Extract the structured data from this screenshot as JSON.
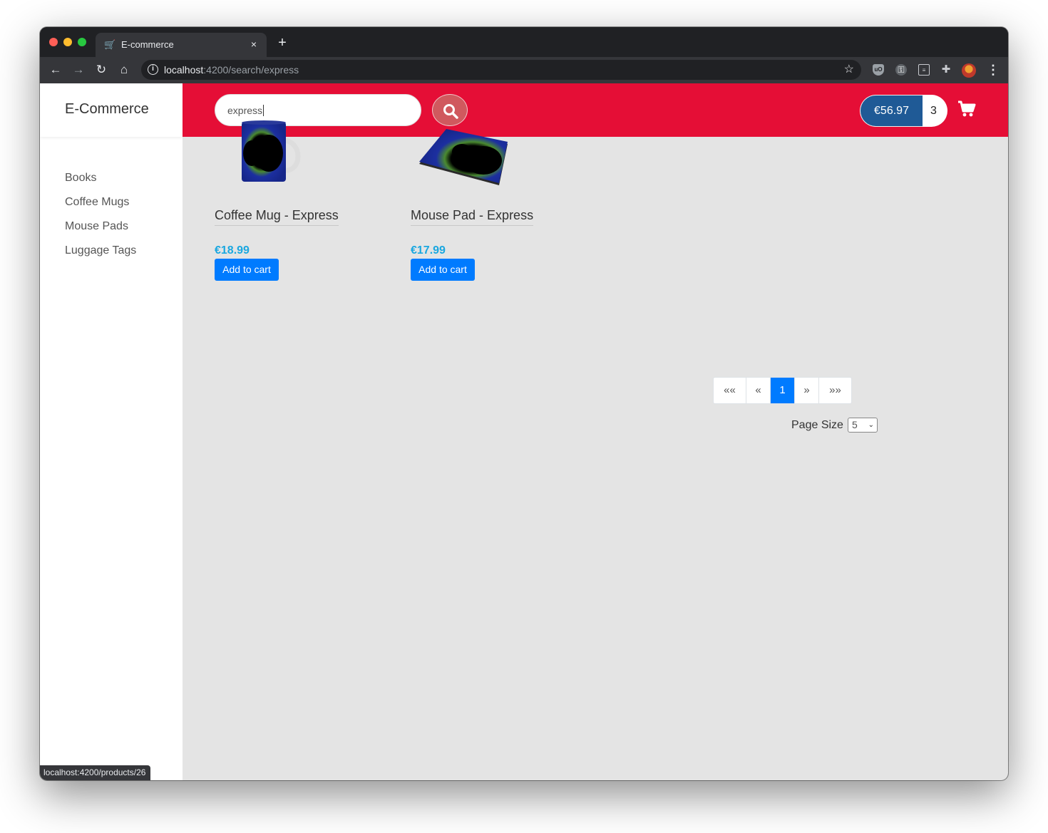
{
  "browser": {
    "tab_title": "E-commerce",
    "tab_close": "×",
    "new_tab": "+",
    "url_host": "localhost",
    "url_rest": ":4200/search/express",
    "status_url": "localhost:4200/products/26"
  },
  "app": {
    "brand": "E-Commerce",
    "categories": [
      "Books",
      "Coffee Mugs",
      "Mouse Pads",
      "Luggage Tags"
    ],
    "search": {
      "value": "express"
    },
    "cart": {
      "total": "€56.97",
      "count": "3"
    },
    "colors": {
      "header": "#e50e36",
      "price": "#1aa7e0",
      "button": "#007bff",
      "cart_total": "#1f5a96"
    }
  },
  "products": [
    {
      "name": "Coffee Mug - Express",
      "price": "€18.99",
      "button": "Add to cart",
      "image_icon": "mug-image"
    },
    {
      "name": "Mouse Pad - Express",
      "price": "€17.99",
      "button": "Add to cart",
      "image_icon": "mousepad-image"
    }
  ],
  "pagination": {
    "first": "««",
    "prev": "«",
    "current": "1",
    "next": "»",
    "last": "»»",
    "page_size_label": "Page Size",
    "page_size_value": "5"
  }
}
